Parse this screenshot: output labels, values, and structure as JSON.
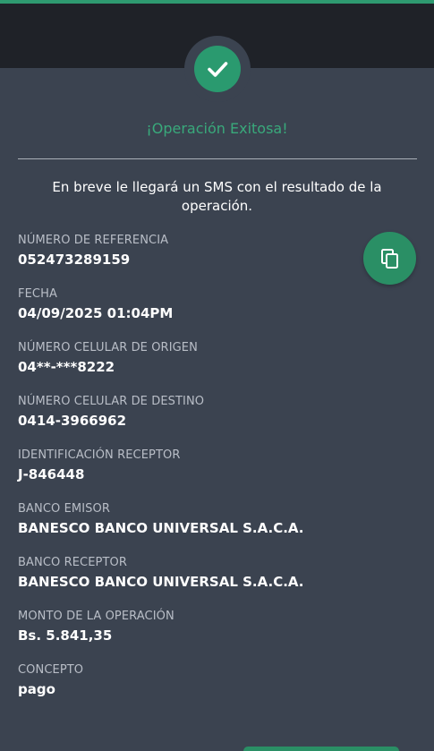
{
  "header": {
    "title": "¡Operación Exitosa!",
    "message": "En breve le llegará un SMS con el resultado de la operación."
  },
  "fields": [
    {
      "label": "NÚMERO DE REFERENCIA",
      "value": "052473289159"
    },
    {
      "label": "FECHA",
      "value": "04/09/2025 01:04PM"
    },
    {
      "label": "NÚMERO CELULAR DE ORIGEN",
      "value": "04**-***8222"
    },
    {
      "label": "NÚMERO CELULAR DE DESTINO",
      "value": "0414-3966962"
    },
    {
      "label": "IDENTIFICACIÓN RECEPTOR",
      "value": "J-846448"
    },
    {
      "label": "BANCO EMISOR",
      "value": "BANESCO BANCO UNIVERSAL S.A.C.A."
    },
    {
      "label": "BANCO RECEPTOR",
      "value": "BANESCO BANCO UNIVERSAL S.A.C.A."
    },
    {
      "label": "MONTO DE LA OPERACIÓN",
      "value": "Bs. 5.841,35"
    },
    {
      "label": "CONCEPTO",
      "value": "pago"
    }
  ],
  "icons": {
    "success": "check-icon",
    "copy": "copy-icon"
  },
  "colors": {
    "background": "#3b4350",
    "header_band": "#1f2228",
    "accent": "#2a9a6f",
    "title": "#39a97b"
  }
}
